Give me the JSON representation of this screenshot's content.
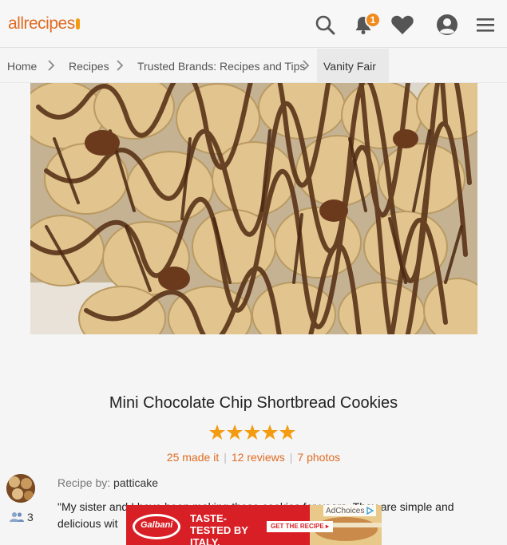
{
  "header": {
    "logo_text": "allrecipes",
    "notification_count": "1",
    "brand_color": "#e06c23"
  },
  "breadcrumb": {
    "items": [
      "Home",
      "Recipes",
      "Trusted Brands: Recipes and Tips",
      "Vanity Fair"
    ]
  },
  "recipe": {
    "title": "Mini Chocolate Chip Shortbread Cookies",
    "rating": 5,
    "made_it": "25 made it",
    "reviews": "12 reviews",
    "photos": "7 photos",
    "byline_label": "Recipe by:",
    "author": "patticake",
    "followers": "3",
    "description": "\"My sister and I have been making these cookies for years. They are simple and delicious wit"
  },
  "ad": {
    "brand": "Galbani",
    "headline": "TASTE-TESTED BY ITALY.",
    "cta": "GET THE RECIPE ▸",
    "adchoices_label": "AdChoices"
  }
}
